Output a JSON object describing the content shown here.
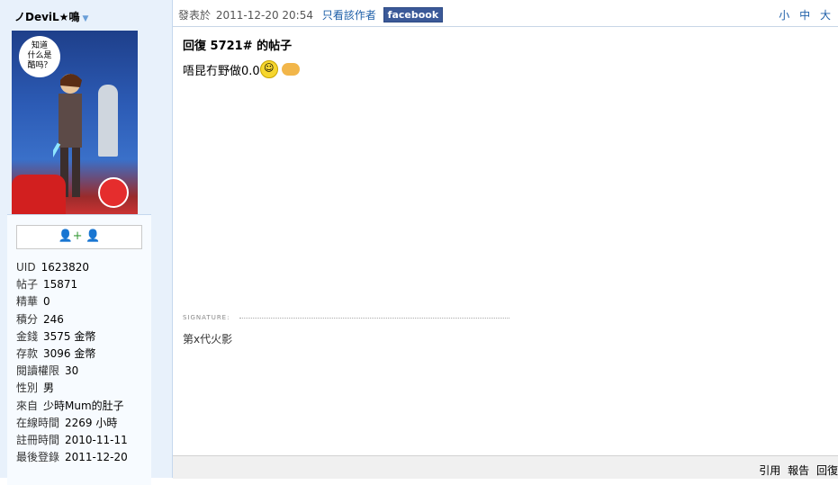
{
  "user": {
    "name": "ノDeviL★鳴",
    "avatar_bubble": "知道\n什么是\n酷吗？"
  },
  "profile": {
    "stats": [
      {
        "label": "UID",
        "value": "1623820"
      },
      {
        "label": "帖子",
        "value": "15871"
      },
      {
        "label": "精華",
        "value": "0"
      },
      {
        "label": "積分",
        "value": "246"
      },
      {
        "label": "金錢",
        "value": "3575 金幣"
      },
      {
        "label": "存款",
        "value": "3096 金幣"
      },
      {
        "label": "閱讀權限",
        "value": "30"
      },
      {
        "label": "性別",
        "value": "男"
      },
      {
        "label": "來自",
        "value": "少時Mum的肚子"
      },
      {
        "label": "在線時間",
        "value": "2269 小時"
      },
      {
        "label": "註冊時間",
        "value": "2010-11-11"
      },
      {
        "label": "最後登錄",
        "value": "2011-12-20"
      }
    ]
  },
  "post": {
    "meta_label": "發表於",
    "timestamp": "2011-12-20 20:54",
    "only_author": "只看該作者",
    "facebook": "facebook",
    "font_sizes": [
      "小",
      "中",
      "大"
    ],
    "title": "回復 5721# 的帖子",
    "body": "唔昆冇野做0.0",
    "signature_label": "SIGNATURE:",
    "signature": "第x代火影",
    "actions": [
      "引用",
      "報告",
      "回復"
    ]
  }
}
